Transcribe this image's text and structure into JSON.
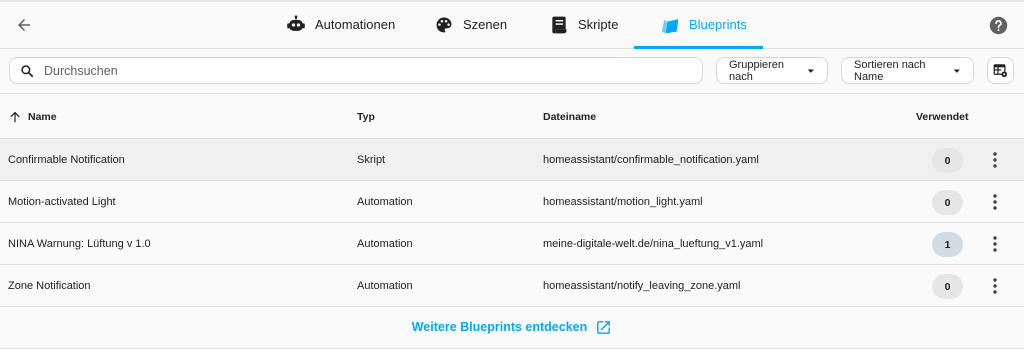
{
  "tabs": [
    {
      "label": "Automationen",
      "icon": "robot-icon",
      "active": false
    },
    {
      "label": "Szenen",
      "icon": "palette-icon",
      "active": false
    },
    {
      "label": "Skripte",
      "icon": "script-icon",
      "active": false
    },
    {
      "label": "Blueprints",
      "icon": "blueprint-icon",
      "active": true
    }
  ],
  "toolbar": {
    "search_placeholder": "Durchsuchen",
    "group_label": "Gruppieren nach",
    "sort_label": "Sortieren nach Name"
  },
  "table": {
    "columns": [
      "Name",
      "Typ",
      "Dateiname",
      "Verwendet"
    ],
    "sort_column": "Name",
    "sort_direction": "ascending",
    "rows": [
      {
        "name": "Confirmable Notification",
        "typ": "Skript",
        "datei": "homeassistant/confirmable_notification.yaml",
        "verwendet": "0"
      },
      {
        "name": "Motion-activated Light",
        "typ": "Automation",
        "datei": "homeassistant/motion_light.yaml",
        "verwendet": "0"
      },
      {
        "name": "NINA Warnung: Lüftung v 1.0",
        "typ": "Automation",
        "datei": "meine-digitale-welt.de/nina_lueftung_v1.yaml",
        "verwendet": "1"
      },
      {
        "name": "Zone Notification",
        "typ": "Automation",
        "datei": "homeassistant/notify_leaving_zone.yaml",
        "verwendet": "0"
      }
    ]
  },
  "footer": {
    "link_label": "Weitere Blueprints entdecken"
  },
  "colors": {
    "accent": "#03a9f4",
    "text": "#212121",
    "divider": "#e0e0e0"
  }
}
